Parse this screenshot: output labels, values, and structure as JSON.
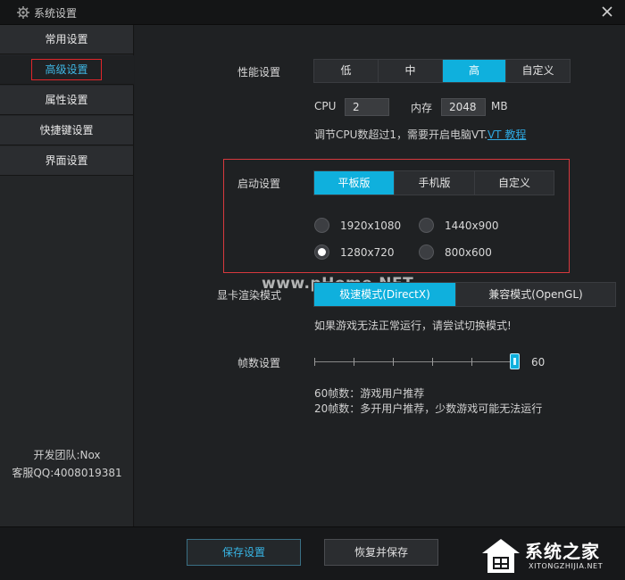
{
  "window": {
    "title": "系统设置",
    "icon": "gear-icon",
    "close_icon": "close-icon"
  },
  "sidebar": {
    "items": [
      {
        "label": "常用设置"
      },
      {
        "label": "高级设置",
        "active": true
      },
      {
        "label": "属性设置"
      },
      {
        "label": "快捷键设置"
      },
      {
        "label": "界面设置"
      }
    ],
    "team": "开发团队:Nox",
    "qq": "客服QQ:4008019381"
  },
  "performance": {
    "label": "性能设置",
    "options": [
      "低",
      "中",
      "高",
      "自定义"
    ],
    "selected": "高",
    "cpu_label": "CPU",
    "cpu_value": "2",
    "mem_label": "内存",
    "mem_value": "2048",
    "mem_unit": "MB",
    "hint_text": "调节CPU数超过1，需要开启电脑VT.",
    "hint_link": "VT 教程"
  },
  "startup": {
    "label": "启动设置",
    "options": [
      "平板版",
      "手机版",
      "自定义"
    ],
    "selected": "平板版",
    "resolutions": [
      "1920x1080",
      "1440x900",
      "1280x720",
      "800x600"
    ],
    "selected_resolution": "1280x720"
  },
  "render": {
    "label": "显卡渲染模式",
    "options": [
      "极速模式(DirectX)",
      "兼容模式(OpenGL)"
    ],
    "selected": "极速模式(DirectX)",
    "hint": "如果游戏无法正常运行，请尝试切换模式!"
  },
  "fps": {
    "label": "帧数设置",
    "value": "60",
    "slider_fraction": 1.0,
    "notes": [
      "60帧数：游戏用户推荐",
      "20帧数：多开用户推荐，少数游戏可能无法运行"
    ]
  },
  "footer": {
    "save": "保存设置",
    "restore": "恢复并保存"
  },
  "watermark": "www.pHome.NET",
  "brand": {
    "name": "系统之家",
    "sub": "XITONGZHIJIA.NET"
  },
  "colors": {
    "accent": "#0fb0dd",
    "highlight": "#e0262a"
  }
}
